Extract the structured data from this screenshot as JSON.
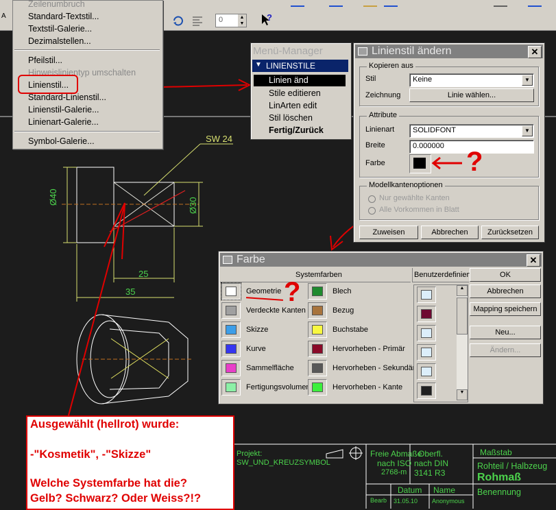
{
  "toolbar": {
    "spinner_value": "0",
    "help_icon": "?"
  },
  "menu": {
    "items": [
      {
        "label": "Zeilenumbruch",
        "disabled": true
      },
      {
        "label": "Standard-Textstil...",
        "disabled": false
      },
      {
        "label": "Textstil-Galerie...",
        "disabled": false
      },
      {
        "label": "Dezimalstellen...",
        "disabled": false
      },
      {
        "label": "Pfeilstil...",
        "disabled": false
      },
      {
        "label": "Hinweislinientyp umschalten",
        "disabled": true
      },
      {
        "label": "Linienstil...",
        "disabled": false
      },
      {
        "label": "Standard-Linienstil...",
        "disabled": false
      },
      {
        "label": "Linienstil-Galerie...",
        "disabled": false
      },
      {
        "label": "Linienart-Galerie...",
        "disabled": false
      },
      {
        "label": "Symbol-Galerie...",
        "disabled": false
      }
    ]
  },
  "menu_manager": {
    "title": "Menü-Manager",
    "header": "LINIENSTILE",
    "items": [
      "Linien änd",
      "Stile editieren",
      "LinArten edit",
      "Stil löschen",
      "Fertig/Zurück"
    ]
  },
  "linienstil": {
    "title": "Linienstil ändern",
    "kopieren_aus": "Kopieren aus",
    "stil_label": "Stil",
    "stil_value": "Keine",
    "zeichnung_label": "Zeichnung",
    "linie_waehlen": "Linie wählen...",
    "attribute": "Attribute",
    "linienart_label": "Linienart",
    "linienart_value": "SOLIDFONT",
    "breite_label": "Breite",
    "breite_value": "0.000000",
    "farbe_label": "Farbe",
    "farbe_color": "#000000",
    "modellkanten": "Modellkantenoptionen",
    "radio1": "Nur gewählte Kanten",
    "radio2": "Alle Vorkommen in Blatt",
    "zuweisen": "Zuweisen",
    "abbrechen": "Abbrechen",
    "zuruecksetzen": "Zurücksetzen"
  },
  "farbe": {
    "title": "Farbe",
    "systemfarben": "Systemfarben",
    "benutzerdefiniert": "Benutzerdefiniert",
    "left_colors": [
      {
        "name": "Geometrie",
        "color": "#ffffff"
      },
      {
        "name": "Verdeckte Kanten",
        "color": "#a0a0a0"
      },
      {
        "name": "Skizze",
        "color": "#3d9ee8"
      },
      {
        "name": "Kurve",
        "color": "#3535f0"
      },
      {
        "name": "Sammelfläche",
        "color": "#e83ec8"
      },
      {
        "name": "Fertigungsvolumen",
        "color": "#8cf0a6"
      }
    ],
    "right_colors": [
      {
        "name": "Blech",
        "color": "#1f8a2e"
      },
      {
        "name": "Bezug",
        "color": "#a8743c"
      },
      {
        "name": "Buchstabe",
        "color": "#f8f840"
      },
      {
        "name": "Hervorheben - Primär",
        "color": "#8a0a28"
      },
      {
        "name": "Hervorheben - Sekundär",
        "color": "#585858"
      },
      {
        "name": "Hervorheben - Kante",
        "color": "#3cf03c"
      }
    ],
    "custom_colors": [
      "#dceefa",
      "#6e0a32",
      "#dceefa",
      "#dceefa",
      "#dceefa",
      "#202020"
    ],
    "ok": "OK",
    "abbrechen": "Abbrechen",
    "mapping": "Mapping speichern",
    "neu": "Neu...",
    "aendern": "Ändern..."
  },
  "drawing": {
    "sw_label": "SW 24",
    "dim_40": "Ø40",
    "dim_30": "Ø30",
    "dim_25": "25",
    "dim_35": "35"
  },
  "title_block": {
    "projekt_label": "Projekt:",
    "projekt_value": "SW_UND_KREUZSYMBOL",
    "freie_1": "Freie Abmaße",
    "freie_2": "nach ISO",
    "freie_3": "2768-m",
    "oberfl_1": "Oberfl.",
    "oberfl_2": "nach DIN",
    "oberfl_3": "3141 R3",
    "massstab": "Maßstab",
    "rohteil": "Rohteil / Halbzeug",
    "rohmass": "Rohmaß",
    "datum": "Datum",
    "name": "Name",
    "bearb": "Bearb",
    "datum_value": "31.05.10",
    "name_value": "Anonymous",
    "benennung": "Benennung"
  },
  "annotation": {
    "line1": "Ausgewählt (hellrot) wurde:",
    "line2": "-\"Kosmetik\", -\"Skizze\"",
    "line3": "Welche Systemfarbe hat die?",
    "line4": "Gelb? Schwarz? Oder Weiss?!?"
  },
  "marks": {
    "q": "?"
  }
}
